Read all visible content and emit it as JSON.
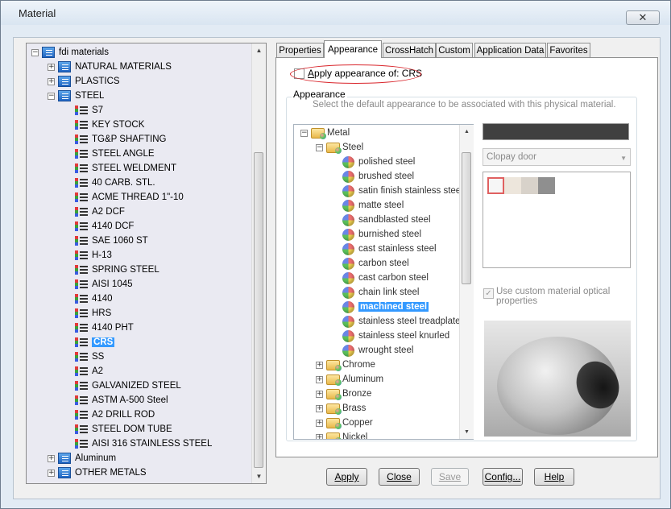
{
  "window": {
    "title": "Material",
    "close_icon": "✕"
  },
  "left_tree": {
    "root": "fdi materials",
    "groups": [
      {
        "label": "NATURAL MATERIALS",
        "expanded": false
      },
      {
        "label": "PLASTICS",
        "expanded": false
      },
      {
        "label": "STEEL",
        "expanded": true
      }
    ],
    "steel_items": [
      "S7",
      "KEY STOCK",
      "TG&P SHAFTING",
      "STEEL ANGLE",
      "STEEL WELDMENT",
      "40 CARB. STL.",
      "ACME THREAD 1\"-10",
      "A2 DCF",
      "4140 DCF",
      "SAE 1060 ST",
      "H-13",
      "SPRING STEEL",
      "AISI 1045",
      "4140",
      "HRS",
      "4140 PHT",
      "CRS",
      "SS",
      "A2",
      "GALVANIZED STEEL",
      "ASTM A-500 Steel",
      "A2 DRILL ROD",
      "STEEL DOM TUBE",
      "AISI 316 STAINLESS STEEL"
    ],
    "selected": "CRS",
    "after_groups": [
      "Aluminum",
      "OTHER METALS"
    ]
  },
  "tabs": [
    "Properties",
    "Appearance",
    "CrossHatch",
    "Custom",
    "Application Data",
    "Favorites"
  ],
  "active_tab": "Appearance",
  "appearance": {
    "apply_label": "Apply appearance of: CRS",
    "apply_mnemonic": "A",
    "apply_rest": "pply appearance of: CRS",
    "group_title": "Appearance",
    "description": "Select the default appearance to be associated with this physical material.",
    "tree": {
      "metal": "Metal",
      "steel": "Steel",
      "steel_items": [
        "polished steel",
        "brushed steel",
        "satin finish stainless steel",
        "matte steel",
        "sandblasted steel",
        "burnished steel",
        "cast stainless steel",
        "carbon steel",
        "cast carbon steel",
        "chain link steel",
        "machined steel",
        "stainless steel treadplate",
        "stainless steel knurled",
        "wrought steel"
      ],
      "selected": "machined steel",
      "other_folders": [
        "Chrome",
        "Aluminum",
        "Bronze",
        "Brass",
        "Copper",
        "Nickel"
      ]
    },
    "color_bar": "#404040",
    "combo_value": "Clopay door",
    "chips": [
      "#f6f6f6",
      "#ede6dc",
      "#d8d2ca",
      "#8f8f8f"
    ],
    "custom_optical_label": "Use custom material optical properties",
    "custom_optical_line1": "Use custom material optical",
    "custom_optical_line2": "properties",
    "custom_optical_checked": true
  },
  "buttons": {
    "apply": "Apply",
    "close": "Close",
    "save": "Save",
    "config": "Config...",
    "help": "Help"
  }
}
